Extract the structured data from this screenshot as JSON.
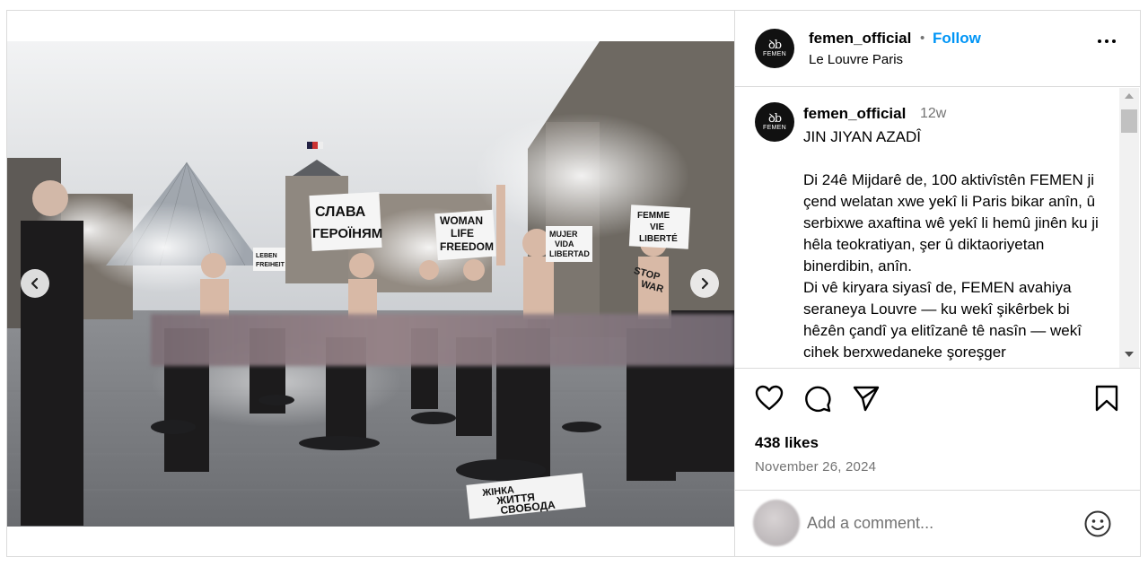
{
  "post": {
    "username": "femen_official",
    "follow_label": "Follow",
    "separator": "•",
    "location": "Le Louvre Paris",
    "avatar_mono": "ꝺb",
    "avatar_word": "FEMEN"
  },
  "caption": {
    "username": "femen_official",
    "time": "12w",
    "title": "JIN JIYAN AZADÎ",
    "paragraph1": "Di 24ê Mijdarê de, 100 aktivîstên FEMEN ji çend welatan xwe yekî li Paris bikar anîn, û serbixwe axaftina wê yekî li hemû jinên ku ji hêla teokratiyan, şer û diktaoriyetan binerdibin, anîn.",
    "paragraph2": "Di vê kiryara siyasî de, FEMEN avahiya seraneya Louvre — ku wekî şikêrbek bi hêzên çandî ya elitîzanê tê nasîn — wekî cihek berxwedaneke şoreşger"
  },
  "photo": {
    "signs": [
      "СЛАВА",
      "ГЕРОЇНЯМ",
      "WOMAN",
      "LIFE",
      "FREEDOM",
      "MUJER",
      "VIDA",
      "LIBERTAD",
      "FEMME",
      "VIE",
      "LIBERTÉ",
      "LEBEN",
      "FREIHEIT",
      "STOP",
      "WAR",
      "ЖІНКА",
      "ЖИТТЯ",
      "СВОБОДА"
    ],
    "dot_count": 18,
    "active_dot": 7
  },
  "stats": {
    "likes": "438 likes",
    "date": "November 26, 2024"
  },
  "comment_box": {
    "placeholder": "Add a comment..."
  },
  "icons": {
    "like": "heart-icon",
    "comment": "comment-icon",
    "share": "share-icon",
    "save": "bookmark-icon",
    "more": "more-icon",
    "emoji": "emoji-icon",
    "prev": "chevron-left-icon",
    "next": "chevron-right-icon"
  },
  "colors": {
    "link": "#0095f6",
    "muted": "#737373",
    "border": "#dbdbdb"
  }
}
